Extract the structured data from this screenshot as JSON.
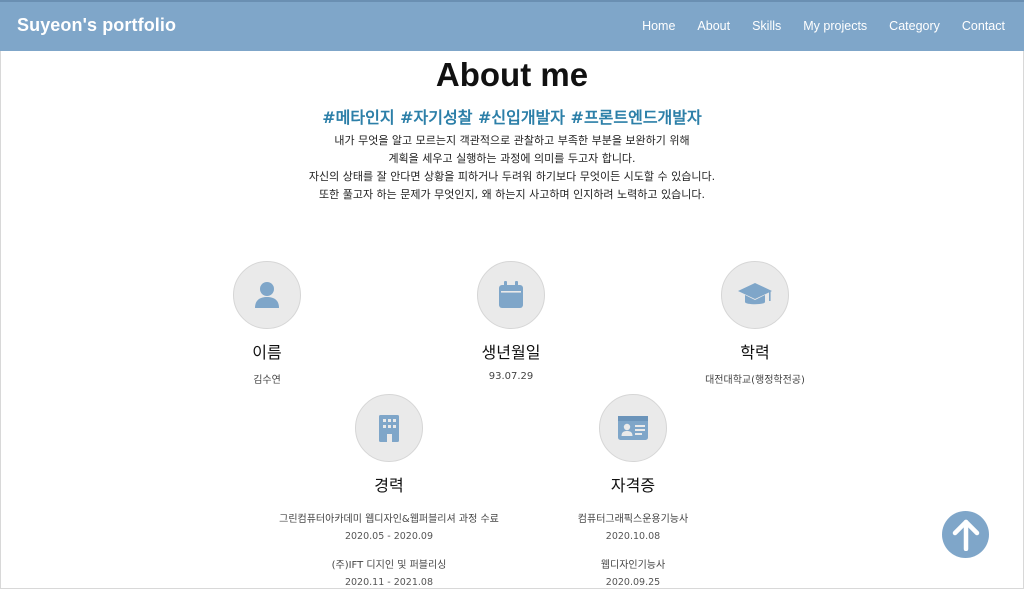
{
  "brand": "Suyeon's portfolio",
  "nav": [
    "Home",
    "About",
    "Skills",
    "My projects",
    "Category",
    "Contact"
  ],
  "about": {
    "title": "About me",
    "tags": "#메타인지 #자기성찰 #신입개발자 #프론트엔드개발자",
    "lines": [
      "내가 무엇을 알고 모르는지 객관적으로 관찰하고 부족한 부분을 보완하기 위해",
      "계획을 세우고 실행하는 과정에 의미를 두고자 합니다.",
      "자신의 상태를 잘 안다면 상황을 피하거나 두려워 하기보다 무엇이든 시도할 수 있습니다.",
      "또한 풀고자 하는 문제가 무엇인지, 왜 하는지 사고하며 인지하려 노력하고 있습니다."
    ]
  },
  "info": {
    "name": {
      "label": "이름",
      "value": "김수연",
      "icon": "person-icon"
    },
    "birth": {
      "label": "생년월일",
      "value": "93.07.29",
      "icon": "calendar-icon"
    },
    "edu": {
      "label": "학력",
      "value": "대전대학교(행정학전공)",
      "icon": "graduation-cap-icon"
    },
    "career": {
      "label": "경력",
      "icon": "building-icon",
      "entries": [
        {
          "title": "그린컴퓨터아카데미 웹디자인&웹퍼블리셔 과정 수료",
          "date": "2020.05 - 2020.09"
        },
        {
          "title": "(주)IFT 디지인 및 퍼블리싱",
          "date": "2020.11 - 2021.08"
        }
      ]
    },
    "cert": {
      "label": "자격증",
      "icon": "id-card-icon",
      "entries": [
        {
          "title": "컴퓨터그래픽스운용기능사",
          "date": "2020.10.08"
        },
        {
          "title": "웹디자인기능사",
          "date": "2020.09.25"
        }
      ]
    }
  },
  "colors": {
    "accent": "#7fa6c9",
    "tag": "#2c7fa8",
    "icon": "#7fa6c9"
  },
  "scroll_top_icon": "arrow-up-icon"
}
